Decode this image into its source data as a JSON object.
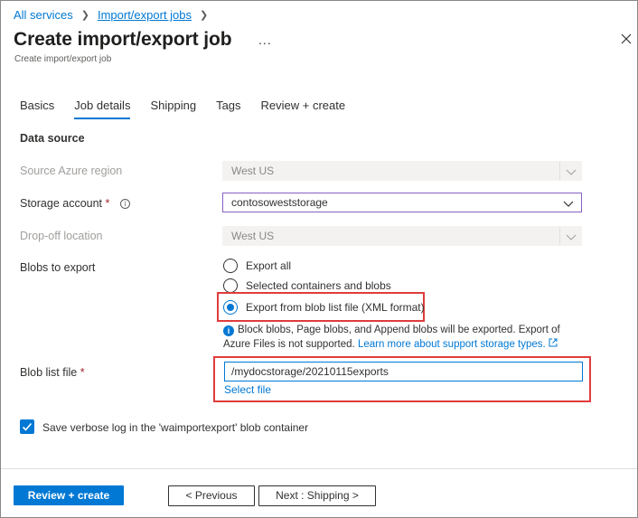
{
  "breadcrumb": {
    "items": [
      "All services",
      "Import/export jobs"
    ]
  },
  "header": {
    "title": "Create import/export job",
    "subtitle": "Create import/export job",
    "more": "..."
  },
  "tabs": [
    {
      "label": "Basics",
      "active": false
    },
    {
      "label": "Job details",
      "active": true
    },
    {
      "label": "Shipping",
      "active": false
    },
    {
      "label": "Tags",
      "active": false
    },
    {
      "label": "Review + create",
      "active": false
    }
  ],
  "section_title": "Data source",
  "fields": {
    "source_region": {
      "label": "Source Azure region",
      "value": "West US",
      "disabled": true
    },
    "storage_account": {
      "label": "Storage account",
      "required": "*",
      "value": "contosoweststorage"
    },
    "dropoff": {
      "label": "Drop-off location",
      "value": "West US",
      "disabled": true
    },
    "blobs": {
      "label": "Blobs to export",
      "options": [
        "Export all",
        "Selected containers and blobs",
        "Export from blob list file (XML format)"
      ],
      "selected": "Export from blob list file (XML format)"
    },
    "note": {
      "text": "Block blobs, Page blobs, and Append blobs will be exported. Export of Azure Files is not supported.",
      "link": "Learn more about support storage types."
    },
    "blob_list": {
      "label": "Blob list file",
      "required": "*",
      "value": "/mydocstorage/20210115exports",
      "select_link": "Select file"
    },
    "verbose": {
      "label": "Save verbose log in the 'waimportexport' blob container",
      "checked": true
    }
  },
  "footer": {
    "review": "Review + create",
    "previous": "< Previous",
    "next": "Next : Shipping >"
  },
  "colors": {
    "accent": "#0078d4",
    "highlight": "#e03c3c",
    "required": "#a4262c"
  }
}
